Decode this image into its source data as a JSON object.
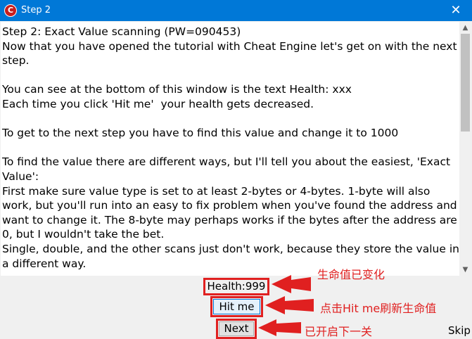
{
  "window": {
    "title": "Step 2",
    "icon_glyph": "C",
    "close_glyph": "✕"
  },
  "tutorial": {
    "text": "Step 2: Exact Value scanning (PW=090453)\nNow that you have opened the tutorial with Cheat Engine let's get on with the next step.\n\nYou can see at the bottom of this window is the text Health: xxx\nEach time you click 'Hit me'  your health gets decreased.\n\nTo get to the next step you have to find this value and change it to 1000\n\nTo find the value there are different ways, but I'll tell you about the easiest, 'Exact Value':\nFirst make sure value type is set to at least 2-bytes or 4-bytes. 1-byte will also work, but you'll run into an easy to fix problem when you've found the address and want to change it. The 8-byte may perhaps works if the bytes after the address are 0, but I wouldn't take the bet.\nSingle, double, and the other scans just don't work, because they store the value in a different way."
  },
  "scrollbar": {
    "up_glyph": "▲",
    "down_glyph": "▼",
    "position": 0
  },
  "health": {
    "label": "Health:999"
  },
  "buttons": {
    "hit_me": "Hit me",
    "next": "Next",
    "skip": "Skip"
  },
  "annotations": {
    "health_changed": "生命值已变化",
    "click_hit_me": "点击Hit me刷新生命值",
    "next_enabled": "已开启下一关"
  },
  "colors": {
    "titlebar": "#0078d7",
    "annotation_red": "#e02020"
  },
  "icons": {
    "app": "cheat-engine-icon",
    "close": "close-icon",
    "scroll_up": "chevron-up-icon",
    "scroll_down": "chevron-down-icon"
  }
}
